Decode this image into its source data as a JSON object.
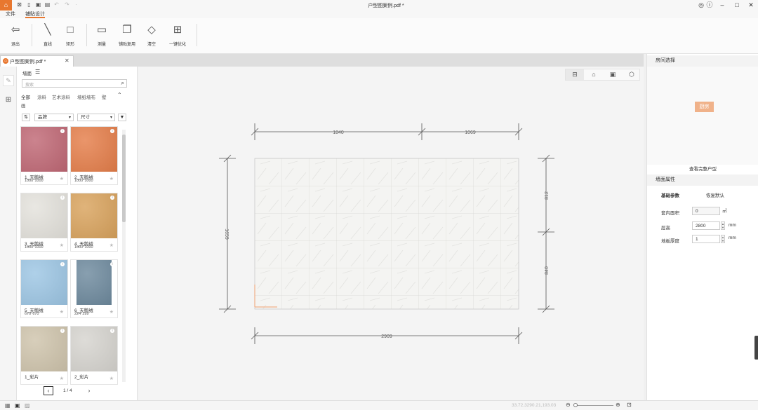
{
  "window": {
    "title": "户型图案例.pdf *"
  },
  "quick_access": [
    "close-doc",
    "new",
    "open",
    "save",
    "undo",
    "redo",
    "more"
  ],
  "menu": {
    "file": "文件",
    "tile_design": "铺贴设计"
  },
  "ribbon": {
    "exit": "退出",
    "line": "直线",
    "rect": "矩形",
    "measure": "测量",
    "tile_apply": "铺贴复用",
    "clear": "清空",
    "optimize": "一键优化"
  },
  "doc_tab": {
    "title": "户型图案例.pdf *"
  },
  "material": {
    "header": "墙面",
    "search_placeholder": "搜索",
    "categories": [
      "全部",
      "涂料",
      "艺术涂料",
      "墙纸墙布",
      "壁",
      "画"
    ],
    "brand": "品牌",
    "size": "尺寸",
    "cards": [
      {
        "name": "1_天鹅绒",
        "size": "1000*1000",
        "color": "#c06875"
      },
      {
        "name": "2_天鹅绒",
        "size": "1000*1000",
        "color": "#e57e4a"
      },
      {
        "name": "3_天鹅绒",
        "size": "1000*1000",
        "color": "#e4e2dc"
      },
      {
        "name": "4_天鹅绒",
        "size": "1000*1000",
        "color": "#d9a35d"
      },
      {
        "name": "5_天鹅绒",
        "size": "670*670",
        "color": "#9dc6e4"
      },
      {
        "name": "6_天鹅绒",
        "size": "224*299",
        "color": "#6e8a9e"
      },
      {
        "name": "1_彩片",
        "size": "",
        "color": "#cfc4ac"
      },
      {
        "name": "2_彩片",
        "size": "",
        "color": "#d6d4cf"
      }
    ],
    "page": "1 / 4"
  },
  "drawing": {
    "dim_top_left": "1840",
    "dim_top_right": "1069",
    "dim_left": "1659",
    "dim_right_top": "812",
    "dim_right_bottom": "840",
    "dim_bottom": "2909"
  },
  "right": {
    "room_select": "房间选择",
    "room_tag": "厨房",
    "view_full": "查看完整户型",
    "wall_props": "墙面属性",
    "basic_params": "基础参数",
    "restore_default": "恢复默认",
    "area_label": "套内面积",
    "area_value": "0",
    "area_unit": "㎡",
    "height_label": "层高",
    "height_value": "2800",
    "height_unit": "mm",
    "floor_label": "地板厚度",
    "floor_value": "1",
    "floor_unit": "mm"
  },
  "status": {
    "coords": "33.72,3290.21,193.03"
  },
  "colors": {
    "accent": "#e8772f"
  }
}
